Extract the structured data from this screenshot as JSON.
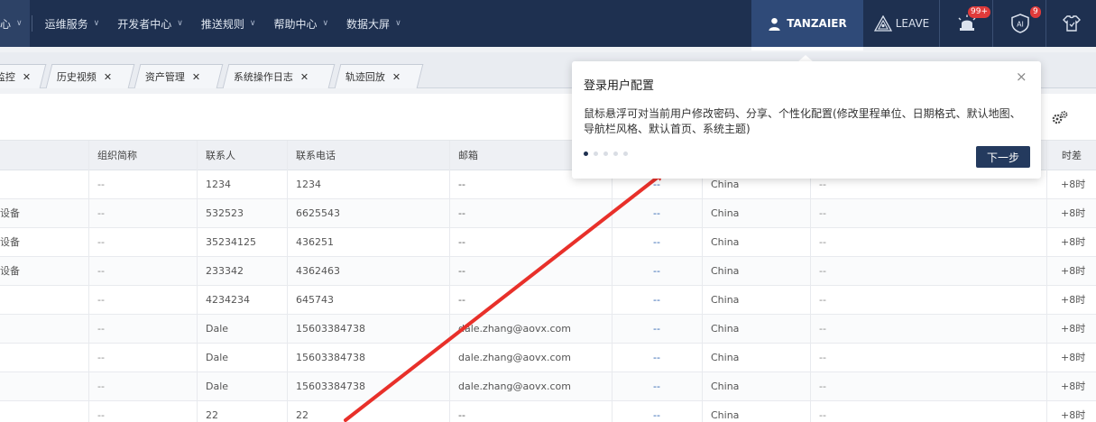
{
  "nav": {
    "menus": [
      {
        "label": "心"
      },
      {
        "label": "运维服务"
      },
      {
        "label": "开发者中心"
      },
      {
        "label": "推送规则"
      },
      {
        "label": "帮助中心"
      },
      {
        "label": "数据大屏"
      }
    ],
    "user": "TANZAIER",
    "leave": "LEAVE",
    "alarm_badge": "99+",
    "ai_badge": "9",
    "ai_label": "AI"
  },
  "tabs": [
    {
      "label": "监控"
    },
    {
      "label": "历史视频"
    },
    {
      "label": "资产管理"
    },
    {
      "label": "系统操作日志"
    },
    {
      "label": "轨迹回放"
    }
  ],
  "table": {
    "headers": {
      "org_short": "组织简称",
      "contact": "联系人",
      "phone": "联系电话",
      "email": "邮箱",
      "timezone": "时差"
    },
    "rows": [
      {
        "c0": "",
        "org": "--",
        "contact": "1234",
        "phone": "1234",
        "email": "--",
        "d1": "--",
        "country": "China",
        "d2": "--",
        "tz": "+8时"
      },
      {
        "c0": "设备",
        "org": "--",
        "contact": "532523",
        "phone": "6625543",
        "email": "--",
        "d1": "--",
        "country": "China",
        "d2": "--",
        "tz": "+8时"
      },
      {
        "c0": "设备",
        "org": "--",
        "contact": "35234125",
        "phone": "436251",
        "email": "--",
        "d1": "--",
        "country": "China",
        "d2": "--",
        "tz": "+8时"
      },
      {
        "c0": "设备",
        "org": "--",
        "contact": "233342",
        "phone": "4362463",
        "email": "--",
        "d1": "--",
        "country": "China",
        "d2": "--",
        "tz": "+8时"
      },
      {
        "c0": "",
        "org": "--",
        "contact": "4234234",
        "phone": "645743",
        "email": "--",
        "d1": "--",
        "country": "China",
        "d2": "--",
        "tz": "+8时"
      },
      {
        "c0": "",
        "org": "--",
        "contact": "Dale",
        "phone": "15603384738",
        "email": "dale.zhang@aovx.com",
        "d1": "--",
        "country": "China",
        "d2": "--",
        "tz": "+8时"
      },
      {
        "c0": "",
        "org": "--",
        "contact": "Dale",
        "phone": "15603384738",
        "email": "dale.zhang@aovx.com",
        "d1": "--",
        "country": "China",
        "d2": "--",
        "tz": "+8时"
      },
      {
        "c0": "",
        "org": "--",
        "contact": "Dale",
        "phone": "15603384738",
        "email": "dale.zhang@aovx.com",
        "d1": "--",
        "country": "China",
        "d2": "--",
        "tz": "+8时"
      },
      {
        "c0": "",
        "org": "--",
        "contact": "22",
        "phone": "22",
        "email": "--",
        "d1": "--",
        "country": "China",
        "d2": "--",
        "tz": "+8时"
      }
    ]
  },
  "popover": {
    "title": "登录用户配置",
    "body": "鼠标悬浮可对当前用户修改密码、分享、个性化配置(修改里程单位、日期格式、默认地图、导航栏风格、默认首页、系统主题)",
    "next_label": "下一步",
    "close": "×"
  },
  "colors": {
    "nav_bg": "#1e3050",
    "user_bg": "#2f4a78",
    "badge": "#e03a3a",
    "annotation_arrow": "#e8302a"
  }
}
